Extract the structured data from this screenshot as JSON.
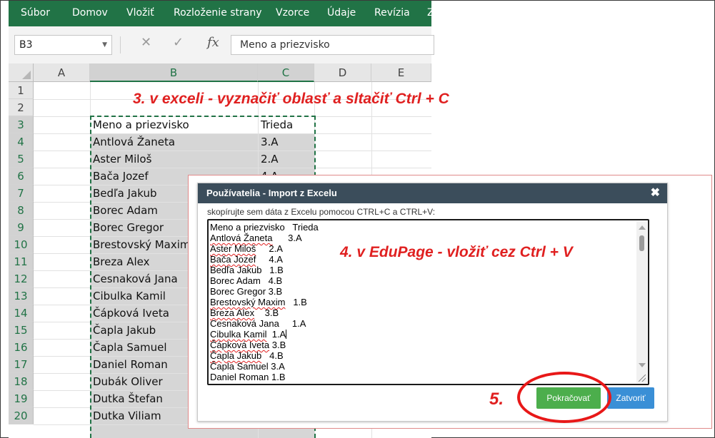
{
  "ribbon": {
    "tabs": [
      "Súbor",
      "Domov",
      "Vložiť",
      "Rozloženie strany",
      "Vzorce",
      "Údaje",
      "Revízia",
      "Z"
    ]
  },
  "formula_bar": {
    "name_box": "B3",
    "cancel_icon": "✕",
    "enter_icon": "✓",
    "fx_label": "fx",
    "value": "Meno a priezvisko"
  },
  "grid": {
    "columns": [
      "A",
      "B",
      "C",
      "D",
      "E"
    ],
    "rows": [
      "1",
      "2",
      "3",
      "4",
      "5",
      "6",
      "7",
      "8",
      "9",
      "10",
      "11",
      "12",
      "13",
      "14",
      "15",
      "16",
      "17",
      "18",
      "19",
      "20"
    ],
    "col_b": [
      "Meno a priezvisko",
      "Antlová Žaneta",
      "Aster Miloš",
      "Bača Jozef",
      "Bedľa Jakub",
      "Borec Adam",
      "Borec Gregor",
      "Brestovský Maxim",
      "Breza Alex",
      "Cesnaková Jana",
      "Cibulka Kamil",
      "Čápková Iveta",
      "Čapla Jakub",
      "Čapla Samuel",
      "Daniel Roman",
      "Dubák Oliver",
      "Dutka Štefan",
      "Dutka Viliam"
    ],
    "col_c": [
      "Trieda",
      "3.A",
      "2.A",
      "4.A"
    ]
  },
  "annotations": {
    "step3": "3. v exceli -  vyznačiť oblasť a sltačiť  Ctrl + C",
    "step4": "4. v EduPage  -  vložiť  cez Ctrl + V",
    "step5": "5."
  },
  "dialog": {
    "title": "Používatelia - Import z Excelu",
    "close": "✖",
    "instruction": "skopírujte sem dáta z Excelu pomocou CTRL+C a CTRL+V:",
    "lines": [
      {
        "name": "Meno a priezvisko",
        "cls": "Trieda"
      },
      {
        "name": "Antlová Žaneta",
        "cls": "3.A"
      },
      {
        "name": "Aster Miloš",
        "cls": "2.A"
      },
      {
        "name": "Bača Jozef",
        "cls": "4.A"
      },
      {
        "name": "Bedľa Jakub",
        "cls": "1.B"
      },
      {
        "name": "Borec Adam",
        "cls": "4.B"
      },
      {
        "name": "Borec Gregor",
        "cls": "3.B"
      },
      {
        "name": "Brestovský Maxim",
        "cls": "1.B"
      },
      {
        "name": "Breza Alex",
        "cls": "3.B"
      },
      {
        "name": "Cesnaková Jana",
        "cls": "1.A"
      },
      {
        "name": "Cibulka Kamil",
        "cls": "1.A"
      },
      {
        "name": "Čápková Iveta",
        "cls": "3.B"
      },
      {
        "name": "Čapla Jakub",
        "cls": "4.B"
      },
      {
        "name": "Čapla Samuel",
        "cls": "3.A"
      },
      {
        "name": "Daniel Roman",
        "cls": "1.B"
      }
    ],
    "continue_button": "Pokračovať",
    "close_button": "Zatvoriť"
  },
  "colors": {
    "excel_green": "#217346",
    "dialog_title_bg": "#3b4d5b",
    "continue_green": "#4cae4c",
    "close_blue": "#3a8fd6",
    "annotation_red": "#e02020"
  }
}
